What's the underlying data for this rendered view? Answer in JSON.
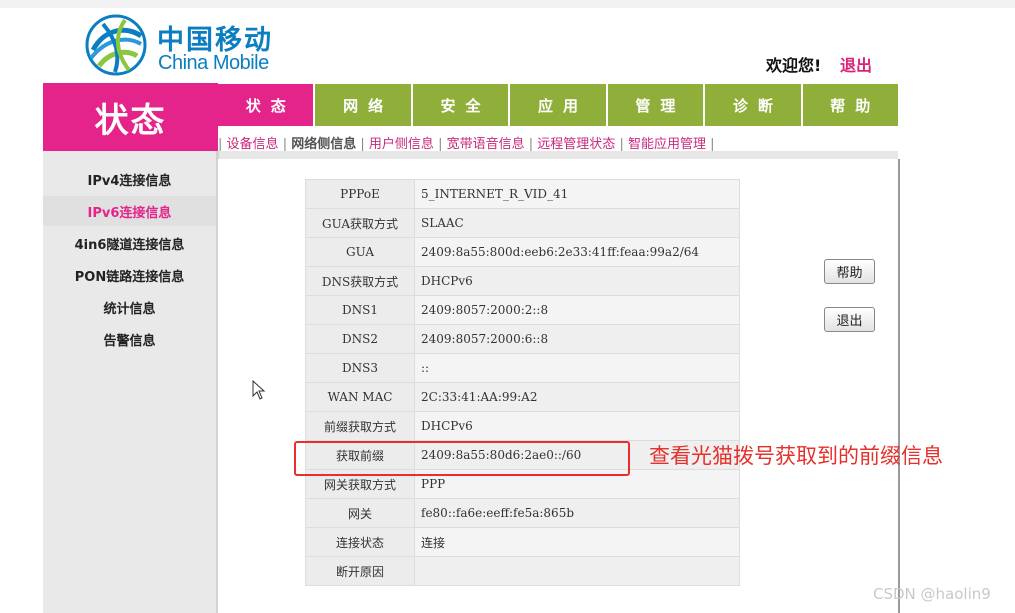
{
  "brand": {
    "name_cn": "中国移动",
    "name_en": "China Mobile",
    "logo_icon": "china-mobile-logo",
    "color": "#0b7ec2"
  },
  "header": {
    "welcome": "欢迎您!",
    "logout": "退出"
  },
  "section_title": "状态",
  "nav": {
    "tabs": [
      {
        "label": "状态",
        "active": true
      },
      {
        "label": "网络",
        "active": false
      },
      {
        "label": "安全",
        "active": false
      },
      {
        "label": "应用",
        "active": false
      },
      {
        "label": "管理",
        "active": false
      },
      {
        "label": "诊断",
        "active": false
      },
      {
        "label": "帮助",
        "active": false
      }
    ],
    "active_color": "#e4238b",
    "tab_color": "#8fae3a"
  },
  "subnav": {
    "separator": "|",
    "items": [
      {
        "label": "设备信息",
        "active": false
      },
      {
        "label": "网络侧信息",
        "active": true
      },
      {
        "label": "用户侧信息",
        "active": false
      },
      {
        "label": "宽带语音信息",
        "active": false
      },
      {
        "label": "远程管理状态",
        "active": false
      },
      {
        "label": "智能应用管理",
        "active": false
      }
    ]
  },
  "sidebar": {
    "items": [
      {
        "label": "IPv4连接信息",
        "active": false
      },
      {
        "label": "IPv6连接信息",
        "active": true
      },
      {
        "label": "4in6隧道连接信息",
        "active": false
      },
      {
        "label": "PON链路连接信息",
        "active": false
      },
      {
        "label": "统计信息",
        "active": false
      },
      {
        "label": "告警信息",
        "active": false
      }
    ]
  },
  "info_table": {
    "rows": [
      {
        "label": "PPPoE",
        "value": "5_INTERNET_R_VID_41"
      },
      {
        "label": "GUA获取方式",
        "value": "SLAAC"
      },
      {
        "label": "GUA",
        "value": "2409:8a55:800d:eeb6:2e33:41ff:feaa:99a2/64"
      },
      {
        "label": "DNS获取方式",
        "value": "DHCPv6"
      },
      {
        "label": "DNS1",
        "value": "2409:8057:2000:2::8"
      },
      {
        "label": "DNS2",
        "value": "2409:8057:2000:6::8"
      },
      {
        "label": "DNS3",
        "value": "::"
      },
      {
        "label": "WAN MAC",
        "value": "2C:33:41:AA:99:A2"
      },
      {
        "label": "前缀获取方式",
        "value": "DHCPv6"
      },
      {
        "label": "获取前缀",
        "value": "2409:8a55:80d6:2ae0::/60"
      },
      {
        "label": "网关获取方式",
        "value": "PPP"
      },
      {
        "label": "网关",
        "value": "fe80::fa6e:eeff:fe5a:865b"
      },
      {
        "label": "连接状态",
        "value": "连接"
      },
      {
        "label": "断开原因",
        "value": ""
      }
    ]
  },
  "buttons": {
    "help": "帮助",
    "logout": "退出"
  },
  "annotation": {
    "text": "查看光猫拨号获取到的前缀信息",
    "color": "#e5302c"
  },
  "watermark": "CSDN @haolin9"
}
